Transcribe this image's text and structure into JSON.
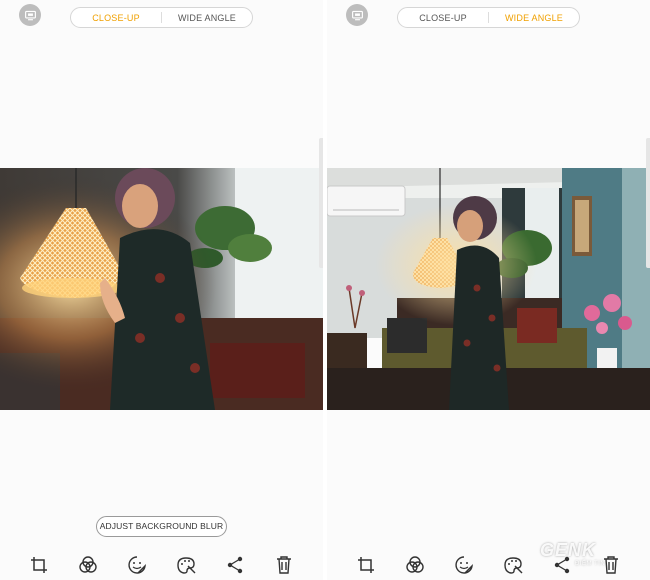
{
  "left_panel": {
    "tabs": [
      {
        "label": "CLOSE-UP",
        "active": true
      },
      {
        "label": "WIDE ANGLE",
        "active": false
      }
    ],
    "adjust_blur_label": "ADJUST BACKGROUND BLUR",
    "photo_icon": "portrait-closeup-photo"
  },
  "right_panel": {
    "tabs": [
      {
        "label": "CLOSE-UP",
        "active": false
      },
      {
        "label": "WIDE ANGLE",
        "active": true
      }
    ],
    "photo_icon": "wide-angle-room-photo"
  },
  "toolbar_icons": [
    "crop-icon",
    "filter-icon",
    "sticker-icon",
    "palette-icon",
    "share-icon",
    "trash-icon"
  ],
  "watermark": {
    "text": "GENK",
    "subtext": "ĐIỂM TIN"
  },
  "colors": {
    "active": "#f0a000",
    "inactive": "#555555",
    "background": "#fbfbfb"
  }
}
